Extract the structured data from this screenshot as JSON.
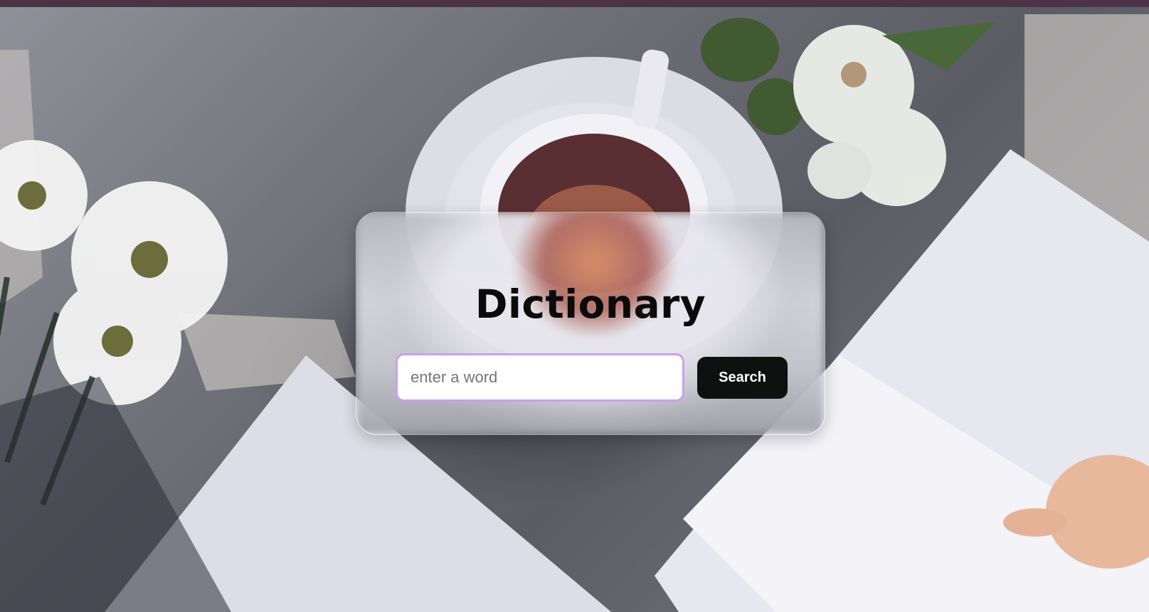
{
  "app": {
    "title": "Dictionary"
  },
  "search": {
    "placeholder": "enter a word",
    "value": "",
    "button_label": "Search"
  },
  "colors": {
    "top_bar": "#4a3345",
    "input_border": "#caa0ec",
    "button_bg": "#0f1111",
    "button_text": "#ffffff",
    "title": "#0b0b0b"
  },
  "background": {
    "icon": "coffee-flowers-books-photo"
  }
}
